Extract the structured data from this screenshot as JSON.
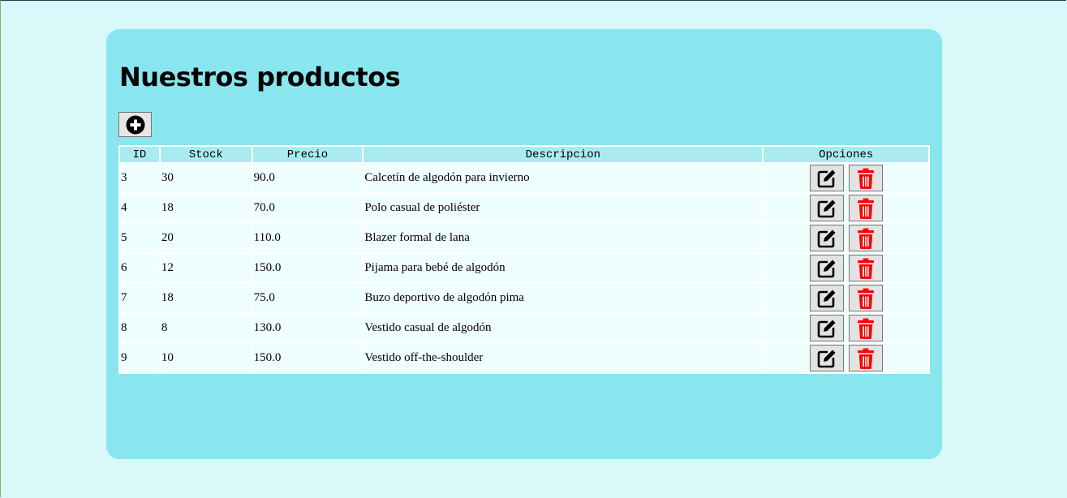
{
  "page": {
    "title": "Nuestros productos"
  },
  "colors": {
    "background": "#d8f8f9",
    "panel": "#89e6ee",
    "header": "#a8ecf2",
    "row": "#effffe",
    "delete_icon": "#ff0000"
  },
  "toolbar": {
    "add_icon": "plus-circle-icon"
  },
  "table": {
    "columns": [
      "ID",
      "Stock",
      "Precio",
      "Descripcion",
      "Opciones"
    ],
    "rows": [
      {
        "id": "3",
        "stock": "30",
        "precio": "90.0",
        "descripcion": "Calcetín de algodón para invierno"
      },
      {
        "id": "4",
        "stock": "18",
        "precio": "70.0",
        "descripcion": "Polo casual de poliéster"
      },
      {
        "id": "5",
        "stock": "20",
        "precio": "110.0",
        "descripcion": "Blazer formal de lana"
      },
      {
        "id": "6",
        "stock": "12",
        "precio": "150.0",
        "descripcion": "Pijama para bebé de algodón"
      },
      {
        "id": "7",
        "stock": "18",
        "precio": "75.0",
        "descripcion": "Buzo deportivo de algodón pima"
      },
      {
        "id": "8",
        "stock": "8",
        "precio": "130.0",
        "descripcion": "Vestido casual de algodón"
      },
      {
        "id": "9",
        "stock": "10",
        "precio": "150.0",
        "descripcion": "Vestido off-the-shoulder"
      }
    ],
    "row_actions": {
      "edit_icon": "edit-icon",
      "delete_icon": "trash-icon"
    }
  }
}
